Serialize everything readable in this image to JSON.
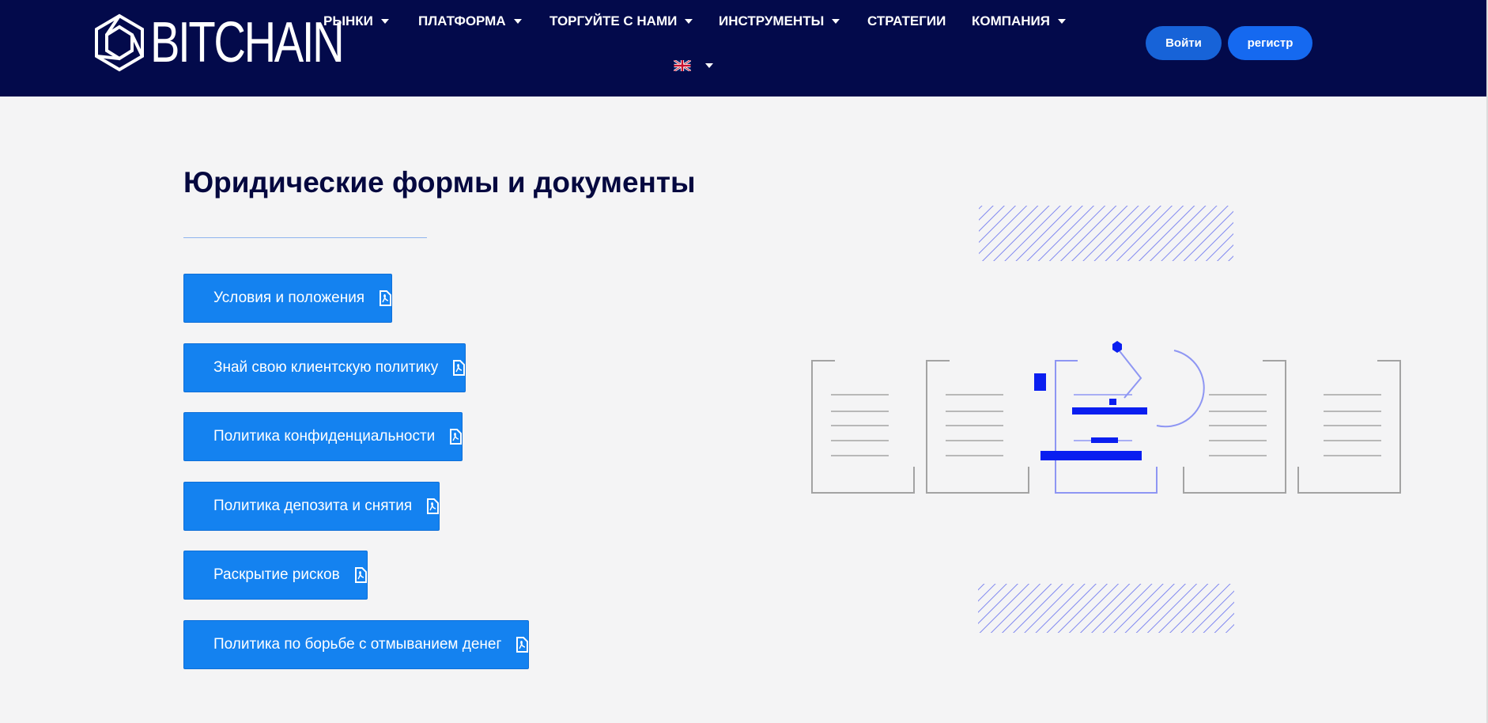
{
  "brand": {
    "name": "BITCHAIN"
  },
  "nav": {
    "items": [
      {
        "label": "РЫНКИ",
        "has_dropdown": true
      },
      {
        "label": "ПЛАТФОРМА",
        "has_dropdown": true
      },
      {
        "label": "ТОРГУЙТЕ С НАМИ",
        "has_dropdown": true
      },
      {
        "label": "ИНСТРУМЕНТЫ",
        "has_dropdown": true
      },
      {
        "label": "СТРАТЕГИИ",
        "has_dropdown": false
      },
      {
        "label": "КОМПАНИЯ",
        "has_dropdown": true
      }
    ],
    "language_icon": "uk-flag-icon"
  },
  "auth": {
    "login_label": "Войти",
    "register_label": "регистр"
  },
  "main": {
    "title": "Юридические формы и документы",
    "documents": [
      {
        "label": "Условия и положения",
        "icon": "pdf-icon"
      },
      {
        "label": "Знай свою клиентскую политику",
        "icon": "pdf-icon"
      },
      {
        "label": "Политика конфиденциальности",
        "icon": "pdf-icon"
      },
      {
        "label": "Политика депозита и снятия",
        "icon": "pdf-icon"
      },
      {
        "label": "Раскрытие рисков",
        "icon": "pdf-icon"
      },
      {
        "label": "Политика по борьбе с отмыванием денег",
        "icon": "pdf-icon"
      }
    ]
  },
  "colors": {
    "header_bg": "#030a4b",
    "page_bg": "#f4f4f5",
    "title": "#05083f",
    "button_blue": "#1482f0",
    "illustration_accent": "#0a1ef0"
  }
}
